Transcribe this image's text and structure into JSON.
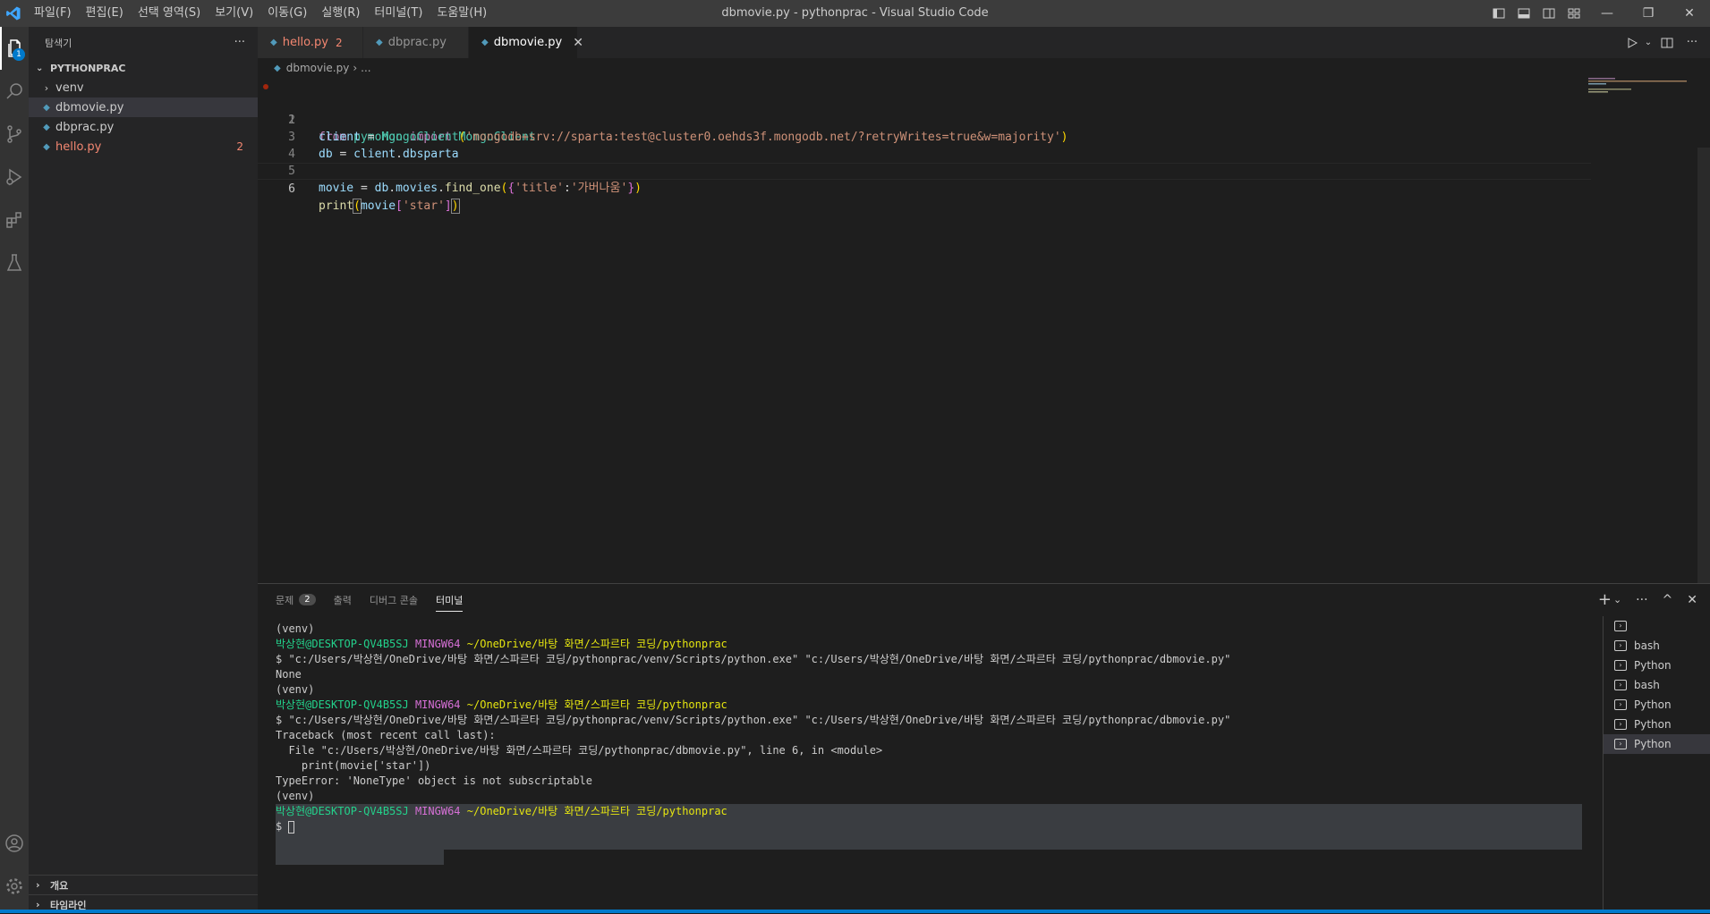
{
  "window": {
    "title": "dbmovie.py - pythonprac - Visual Studio Code"
  },
  "menu": [
    "파일(F)",
    "편집(E)",
    "선택 영역(S)",
    "보기(V)",
    "이동(G)",
    "실행(R)",
    "터미널(T)",
    "도움말(H)"
  ],
  "activity": {
    "explorer_badge": "1"
  },
  "sidebar": {
    "title": "탐색기",
    "more": "···",
    "section": "PYTHONPRAC",
    "items": [
      {
        "name": "venv"
      },
      {
        "name": "dbmovie.py"
      },
      {
        "name": "dbprac.py"
      },
      {
        "name": "hello.py",
        "count": "2"
      }
    ],
    "footer": [
      "개요",
      "타임라인"
    ]
  },
  "tabs": [
    {
      "label": "hello.py",
      "count": "2"
    },
    {
      "label": "dbprac.py"
    },
    {
      "label": "dbmovie.py"
    }
  ],
  "breadcrumb": {
    "file": "dbmovie.py",
    "sep": "›",
    "rest": "..."
  },
  "editor": {
    "line_numbers": [
      "1",
      "2",
      "3",
      "4",
      "5",
      "6"
    ],
    "l1": {
      "a": "from",
      "b": " pymongo ",
      "c": "import",
      "d": " MongoClient"
    },
    "l2": {
      "a": "client",
      "b": " = ",
      "c": "MongoClient",
      "d": "(",
      "e": "'mongodb+srv://sparta:test@cluster0.oehds3f.mongodb.net/?retryWrites=true&w=majority'",
      "f": ")"
    },
    "l3": {
      "a": "db",
      "b": " = ",
      "c": "client",
      "d": ".",
      "e": "dbsparta"
    },
    "l5": {
      "a": "movie",
      "b": " = ",
      "c": "db",
      "d": ".",
      "e": "movies",
      "f": ".",
      "g": "find_one",
      "h": "(",
      "i": "{",
      "j": "'title'",
      "k": ":",
      "l": "'가버나움'",
      "m": "}",
      "n": ")"
    },
    "l6": {
      "a": "print",
      "b": "(",
      "c": "movie",
      "d": "[",
      "e": "'star'",
      "f": "]",
      "g": ")"
    }
  },
  "panel": {
    "tabs": [
      "문제",
      "출력",
      "디버그 콘솔",
      "터미널"
    ],
    "problems_count": "2",
    "actions": {
      "add": "+",
      "chevron": "⌄",
      "more": "···",
      "max": "^",
      "close": "✕"
    }
  },
  "terminal": {
    "venv": "(venv)",
    "user": "박상현",
    "host": "@DESKTOP-QV4B5SJ",
    "shell": "MINGW64",
    "path": "~/OneDrive/바탕 화면/스파르타 코딩/pythonprac",
    "cmd": "$ \"c:/Users/박상현/OneDrive/바탕 화면/스파르타 코딩/pythonprac/venv/Scripts/python.exe\" \"c:/Users/박상현/OneDrive/바탕 화면/스파르타 코딩/pythonprac/dbmovie.py\"",
    "none": "None",
    "tb1": "Traceback (most recent call last):",
    "tb2": "  File \"c:/Users/박상현/OneDrive/바탕 화면/스파르타 코딩/pythonprac/dbmovie.py\", line 6, in <module>",
    "tb3": "    print(movie['star'])",
    "tb4": "TypeError: 'NoneType' object is not subscriptable",
    "prompt": "$ "
  },
  "terminal_list": [
    "bash",
    "Python",
    "bash",
    "Python",
    "Python",
    "Python"
  ]
}
